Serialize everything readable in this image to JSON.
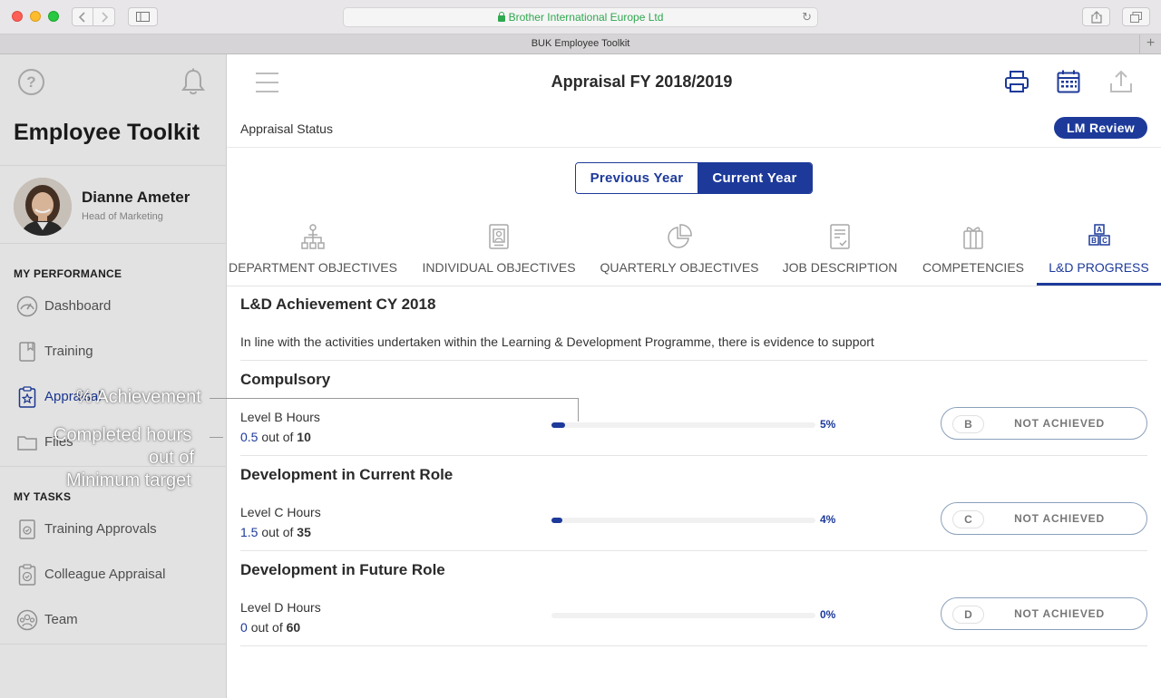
{
  "browser": {
    "url_text": "Brother International Europe Ltd",
    "tab_title": "BUK Employee Toolkit"
  },
  "sidebar": {
    "title": "Employee Toolkit",
    "profile": {
      "name": "Dianne Ameter",
      "role": "Head of Marketing"
    },
    "section_performance": "MY PERFORMANCE",
    "performance_items": [
      {
        "label": "Dashboard",
        "icon": "gauge-icon"
      },
      {
        "label": "Training",
        "icon": "book-icon"
      },
      {
        "label": "Appraisal",
        "icon": "clipboard-star-icon",
        "active": true
      },
      {
        "label": "Files",
        "icon": "folder-icon"
      }
    ],
    "section_tasks": "MY TASKS",
    "task_items": [
      {
        "label": "Training Approvals",
        "icon": "training-approval-icon"
      },
      {
        "label": "Colleague Appraisal",
        "icon": "clipboard-check-icon"
      },
      {
        "label": "Team",
        "icon": "team-icon"
      }
    ]
  },
  "header": {
    "title": "Appraisal FY 2018/2019",
    "status_label": "Appraisal Status",
    "status_badge": "LM Review"
  },
  "year_toggle": {
    "previous": "Previous Year",
    "current": "Current Year",
    "selected": "current"
  },
  "tabs": [
    {
      "label": "DEPARTMENT OBJECTIVES",
      "icon": "org-chart-icon"
    },
    {
      "label": "INDIVIDUAL OBJECTIVES",
      "icon": "id-card-icon"
    },
    {
      "label": "QUARTERLY OBJECTIVES",
      "icon": "pie-chart-icon"
    },
    {
      "label": "JOB DESCRIPTION",
      "icon": "checklist-icon"
    },
    {
      "label": "COMPETENCIES",
      "icon": "gift-icon"
    },
    {
      "label": "L&D PROGRESS",
      "icon": "abc-blocks-icon",
      "active": true
    }
  ],
  "content": {
    "title": "L&D Achievement CY 2018",
    "intro": "In line with the activities undertaken within the Learning & Development Programme, there is evidence to support",
    "out_of": "out of",
    "sections": [
      {
        "title": "Compulsory",
        "row": {
          "label": "Level B Hours",
          "completed": "0.5",
          "target": "10",
          "percent": 5,
          "percent_text": "5%",
          "level": "B",
          "status": "NOT ACHIEVED"
        }
      },
      {
        "title": "Development in Current Role",
        "row": {
          "label": "Level C Hours",
          "completed": "1.5",
          "target": "35",
          "percent": 4,
          "percent_text": "4%",
          "level": "C",
          "status": "NOT ACHIEVED"
        }
      },
      {
        "title": "Development in Future Role",
        "row": {
          "label": "Level D Hours",
          "completed": "0",
          "target": "60",
          "percent": 0,
          "percent_text": "0%",
          "level": "D",
          "status": "NOT ACHIEVED"
        }
      }
    ]
  },
  "callouts": {
    "achievement": "% Achievement",
    "completed_hours": "Completed hours",
    "out_of": "out of",
    "minimum_target": "Minimum target"
  },
  "colors": {
    "brand": "#1d3a9a",
    "status_text": "#777777"
  }
}
